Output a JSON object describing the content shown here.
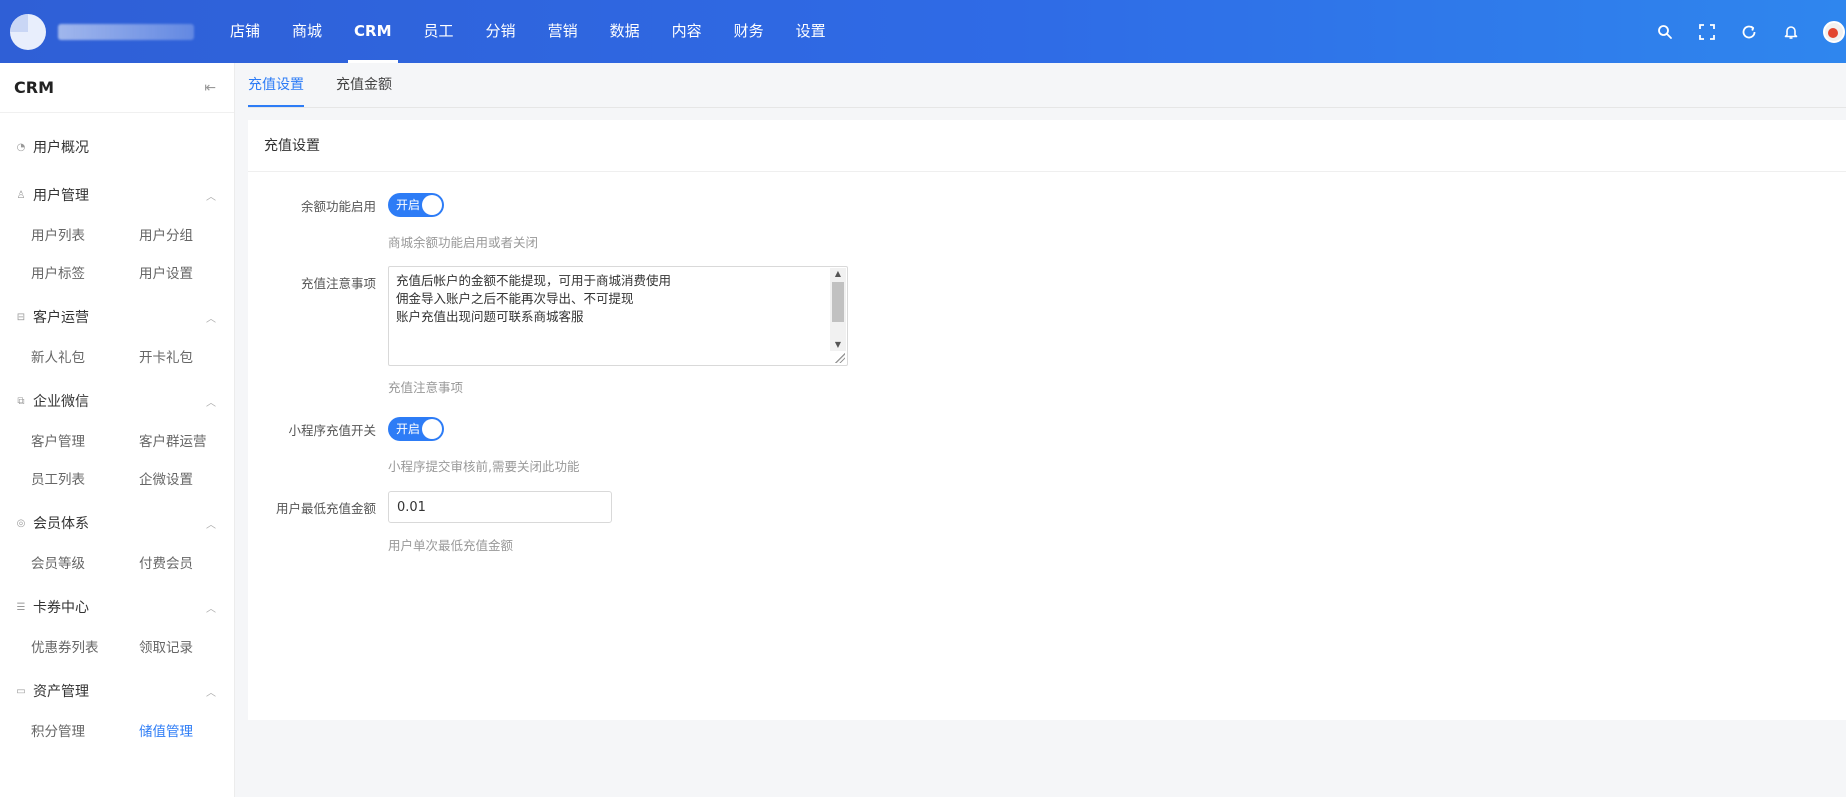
{
  "topbar": {
    "nav": [
      {
        "label": "店铺",
        "active": false
      },
      {
        "label": "商城",
        "active": false
      },
      {
        "label": "CRM",
        "active": true
      },
      {
        "label": "员工",
        "active": false
      },
      {
        "label": "分销",
        "active": false
      },
      {
        "label": "营销",
        "active": false
      },
      {
        "label": "数据",
        "active": false
      },
      {
        "label": "内容",
        "active": false
      },
      {
        "label": "财务",
        "active": false
      },
      {
        "label": "设置",
        "active": false
      }
    ],
    "icons": [
      "search-icon",
      "fullscreen-icon",
      "refresh-icon",
      "bell-icon",
      "avatar"
    ]
  },
  "sidebar": {
    "title": "CRM",
    "overview": "用户概况",
    "groups": [
      {
        "label": "用户管理",
        "icon": "user-icon",
        "items": [
          "用户列表",
          "用户分组",
          "用户标签",
          "用户设置"
        ]
      },
      {
        "label": "客户运营",
        "icon": "gift-icon",
        "items": [
          "新人礼包",
          "开卡礼包"
        ]
      },
      {
        "label": "企业微信",
        "icon": "copy-icon",
        "items": [
          "客户管理",
          "客户群运营",
          "员工列表",
          "企微设置"
        ]
      },
      {
        "label": "会员体系",
        "icon": "member-icon",
        "items": [
          "会员等级",
          "付费会员"
        ]
      },
      {
        "label": "卡券中心",
        "icon": "list-icon",
        "items": [
          "优惠券列表",
          "领取记录"
        ]
      },
      {
        "label": "资产管理",
        "icon": "wallet-icon",
        "items": [
          "积分管理",
          "储值管理"
        ]
      }
    ],
    "active_item": "储值管理"
  },
  "tabs": [
    "充值设置",
    "充值金额"
  ],
  "panel": {
    "title": "充值设置",
    "balance_enable": {
      "label": "余额功能启用",
      "switch_text": "开启",
      "help": "商城余额功能启用或者关闭"
    },
    "notice": {
      "label": "充值注意事项",
      "value": "充值后帐户的金额不能提现，可用于商城消费使用\n佣金导入账户之后不能再次导出、不可提现\n账户充值出现问题可联系商城客服",
      "help": "充值注意事项"
    },
    "miniapp_switch": {
      "label": "小程序充值开关",
      "switch_text": "开启",
      "help": "小程序提交审核前,需要关闭此功能"
    },
    "min_amount": {
      "label": "用户最低充值金额",
      "value": "0.01",
      "help": "用户单次最低充值金额"
    }
  },
  "colors": {
    "primary": "#2d7cf6",
    "topbar": "#2f6be6"
  }
}
